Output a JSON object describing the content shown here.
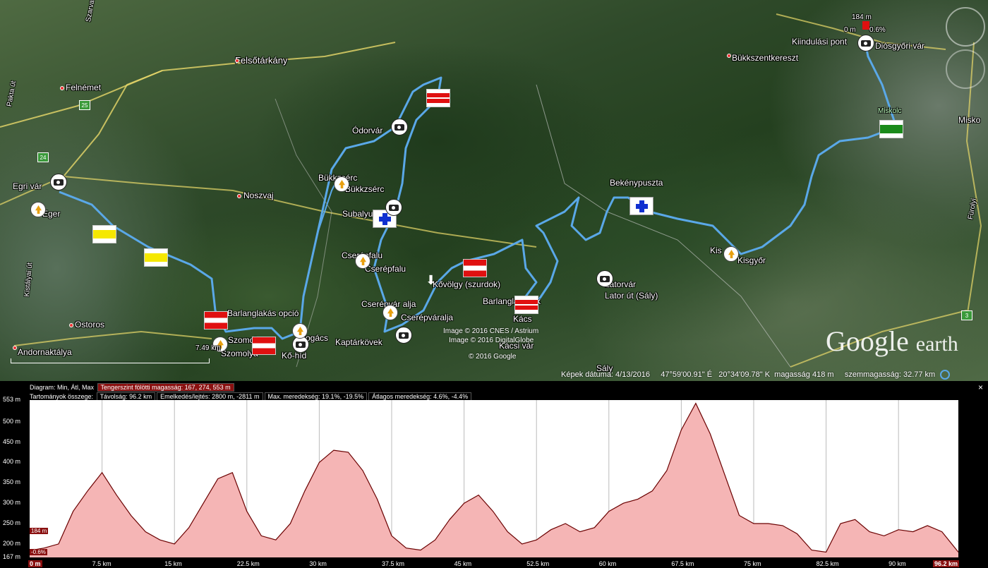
{
  "map": {
    "places": {
      "felsotarkany": "Felsőtárkány",
      "felnemet": "Felnémet",
      "szarvaskoi": "Szarvaskői út",
      "paktarut": "Pakta út",
      "egri_var": "Egri vár",
      "eger": "Eger",
      "noszvaj": "Noszvaj",
      "kistalyai": "Kistályai út",
      "ostoros": "Ostoros",
      "andornaktalya": "Andornaktálya",
      "szomolya1": "Szomol",
      "szomolya2": "Szomolya",
      "barlanglakas": "Barlanglakás opció",
      "bogacs": "Bogács",
      "ko_hid": "Kő-híd",
      "bukkzserc1": "Bükkzsérc",
      "bukkzserc2": "Bükkzsérc",
      "subalyuk": "Subalyuk",
      "odorvar": "Ódorvár",
      "cserepfalu1": "Cserépfalu",
      "cserepfalu2": "Cserépfalu",
      "kovolgy": "Kővölgy (szurdok)",
      "cserepvaralja1": "Cserépvár alja",
      "cserepvaralja2": "Cserépváralja",
      "kaptarkovek": "Kaptárkövek",
      "barlanglakasok": "Barlanglakások",
      "kacs": "Kács",
      "kacsi_var": "Kácsi vár",
      "saly": "Sály",
      "latorvar": "Latorvár",
      "lator_ut": "Lator út (Sály)",
      "bekenypuszta": "Bekénypuszta",
      "kisgyor1": "Kis",
      "kisgyor2": "Kisgyőr",
      "bukkszentkereszt": "Bükkszentkereszt",
      "kiindulasi": "Kiindulási pont",
      "diosgyori": "Diósgyőri vár",
      "miskolc": "Miskolc",
      "misko": "Misko",
      "furolyi": "Fürolyi",
      "scale": "7.49 km"
    },
    "start_marker": {
      "elev": "184 m",
      "pct": "0.6%",
      "dist": "0 m"
    },
    "road_shields": [
      "25",
      "24",
      "3"
    ],
    "copyright": [
      "Image © 2016 CNES / Astrium",
      "Image © 2016 DigitalGlobe",
      "© 2016 Google"
    ],
    "logo": {
      "main": "Google",
      "suffix": "earth"
    },
    "status": {
      "date": "Képek dátuma: 4/13/2016",
      "lat": "47°59'00.91\" É",
      "lon": "20°34'09.78\" K",
      "elev": "magasság   418 m",
      "eye": "szemmagasság:  32.77 km"
    }
  },
  "panel": {
    "row1_label": "Diagram: Min, Átl, Max",
    "row1_value": "Tengerszint fölötti magasság: 167, 274, 553 m",
    "row2_label": "Tartományok összege:",
    "distance": "Távolság: 96.2 km",
    "gain": "Emelkedés/lejtés: 2800 m, -2811 m",
    "maxslope": "Max. meredekség: 19.1%, -19.5%",
    "avgslope": "Átlagos meredekség: 4.6%, -4.4%",
    "close": "×",
    "pin_elev": "184 m",
    "pin_pct": "-0.6%",
    "start": "0 m",
    "end": "96.2 km"
  },
  "chart_data": {
    "type": "area",
    "xlabel": "",
    "ylabel": "",
    "y_ticks": [
      "553 m",
      "500 m",
      "450 m",
      "400 m",
      "350 m",
      "300 m",
      "250 m",
      "200 m",
      "167 m"
    ],
    "x_ticks": [
      "7.5 km",
      "15 km",
      "22.5 km",
      "30 km",
      "37.5 km",
      "45 km",
      "52.5 km",
      "60 km",
      "67.5 km",
      "75 km",
      "82.5 km",
      "90 km"
    ],
    "ylim": [
      167,
      553
    ],
    "xlim": [
      0,
      96.2
    ],
    "x": [
      0,
      1.5,
      3,
      4.5,
      6,
      7.5,
      9,
      10.5,
      12,
      13.5,
      15,
      16.5,
      18,
      19.5,
      21,
      22.5,
      24,
      25.5,
      27,
      28.5,
      30,
      31.5,
      33,
      34.5,
      36,
      37.5,
      39,
      40.5,
      42,
      43.5,
      45,
      46.5,
      48,
      49.5,
      51,
      52.5,
      54,
      55.5,
      57,
      58.5,
      60,
      61.5,
      63,
      64.5,
      66,
      67.5,
      69,
      70.5,
      72,
      73.5,
      75,
      76.5,
      78,
      79.5,
      81,
      82.5,
      84,
      85.5,
      87,
      88.5,
      90,
      91.5,
      93,
      94.5,
      96.2
    ],
    "y": [
      184,
      190,
      200,
      280,
      330,
      375,
      320,
      270,
      230,
      210,
      200,
      240,
      300,
      360,
      375,
      280,
      220,
      210,
      250,
      330,
      400,
      430,
      425,
      380,
      310,
      220,
      190,
      185,
      210,
      260,
      300,
      320,
      280,
      230,
      200,
      210,
      235,
      250,
      230,
      240,
      280,
      300,
      310,
      330,
      380,
      480,
      545,
      470,
      370,
      270,
      250,
      250,
      245,
      225,
      185,
      180,
      250,
      260,
      230,
      220,
      235,
      230,
      245,
      230,
      180
    ]
  }
}
